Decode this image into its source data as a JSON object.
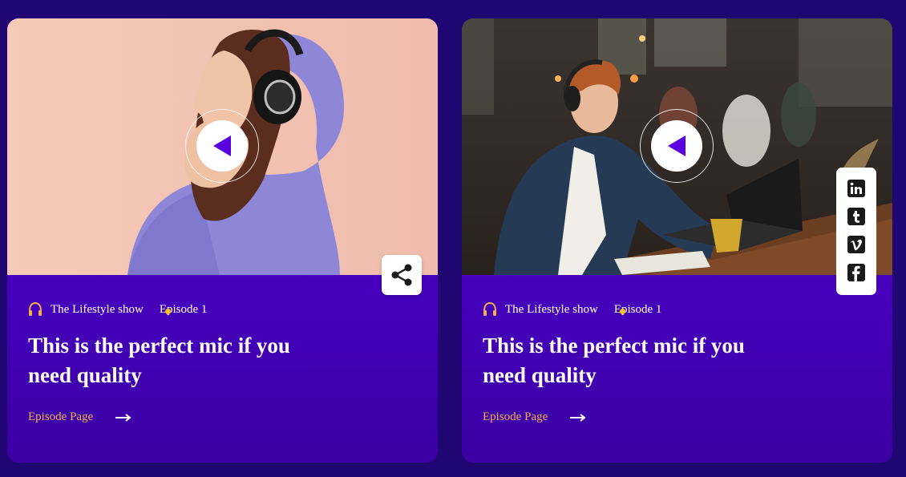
{
  "cards": [
    {
      "show_name": "The Lifestyle show",
      "episode": "Episode 1",
      "title": "This is the perfect mic if you need quality",
      "link_label": "Episode Page"
    },
    {
      "show_name": "The Lifestyle show",
      "episode": "Episode 1",
      "title": "This is the perfect mic if you need quality",
      "link_label": "Episode Page"
    }
  ],
  "icons": {
    "play": "play-icon",
    "headphones": "headphones-icon",
    "arrow": "arrow-right-icon",
    "share": "share-icon",
    "social": [
      "linkedin-icon",
      "tumblr-icon",
      "vimeo-icon",
      "facebook-icon"
    ]
  },
  "colors": {
    "page_bg": "#1f0672",
    "card_top": "#5d00e4",
    "card_bottom": "#3b00a4",
    "accent": "#f4b24a",
    "play_arrow": "#5a00e0"
  }
}
